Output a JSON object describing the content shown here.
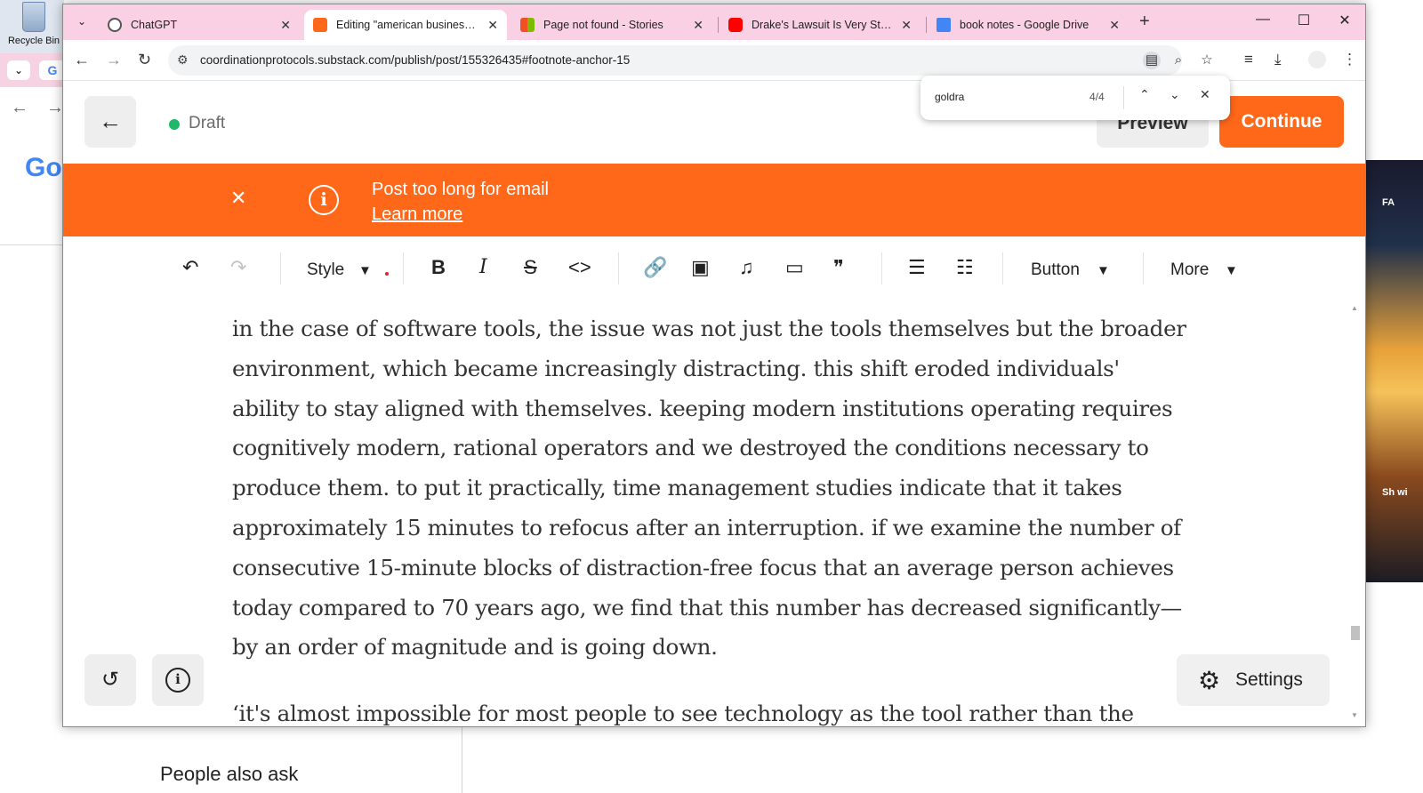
{
  "desktop": {
    "recycle_bin_label": "Recycle Bin"
  },
  "background_window": {
    "tab_g": "G",
    "google_logo_partial": "Go",
    "people_also_ask_partial": "People also ask",
    "right_strip_text_1": "FA",
    "right_strip_text_2": "Sh wi"
  },
  "tabs": [
    {
      "title": "ChatGPT",
      "favicon_color": "#555555",
      "active": false
    },
    {
      "title": "Editing \"american business logic\"",
      "favicon_color": "#ff6719",
      "active": true
    },
    {
      "title": "Page not found - Stories",
      "favicon_color": "#f25022",
      "active": false
    },
    {
      "title": "Drake's Lawsuit Is Very Stupid - YouTube",
      "favicon_color": "#ff0000",
      "active": false
    },
    {
      "title": "book notes - Google Drive",
      "favicon_color": "#4285f4",
      "active": false
    }
  ],
  "address_bar": {
    "url": "coordinationprotocols.substack.com/publish/post/155326435#footnote-anchor-15"
  },
  "find_bar": {
    "query": "goldra",
    "match_count": "4/4"
  },
  "header": {
    "status": "Draft",
    "preview_label": "Preview",
    "continue_label": "Continue"
  },
  "banner": {
    "message": "Post too long for email",
    "link": "Learn more"
  },
  "toolbar": {
    "style_label": "Style",
    "button_label": "Button",
    "more_label": "More"
  },
  "content": {
    "paragraphs": [
      "in the case of software tools, the issue was not just the tools themselves but the broader environment, which became increasingly distracting. this shift eroded individuals' ability to stay aligned with themselves. keeping modern institutions operating requires cognitively modern, rational operators and we destroyed the conditions necessary to produce them. to put it practically, time management studies indicate that it takes approximately 15 minutes to refocus after an interruption. if we examine the number of consecutive 15-minute blocks of distraction-free focus that an average person achieves today compared to 70 years ago, we find that this number has decreased significantly—by an order of magnitude and is going down.",
      "‘it's almost impossible for most people to see technology as the tool rather than the"
    ]
  },
  "bottom": {
    "settings_label": "Settings"
  },
  "colors": {
    "accent": "#ff6719",
    "tab_strip": "#f9d0e4",
    "draft_dot": "#1fb86b"
  }
}
